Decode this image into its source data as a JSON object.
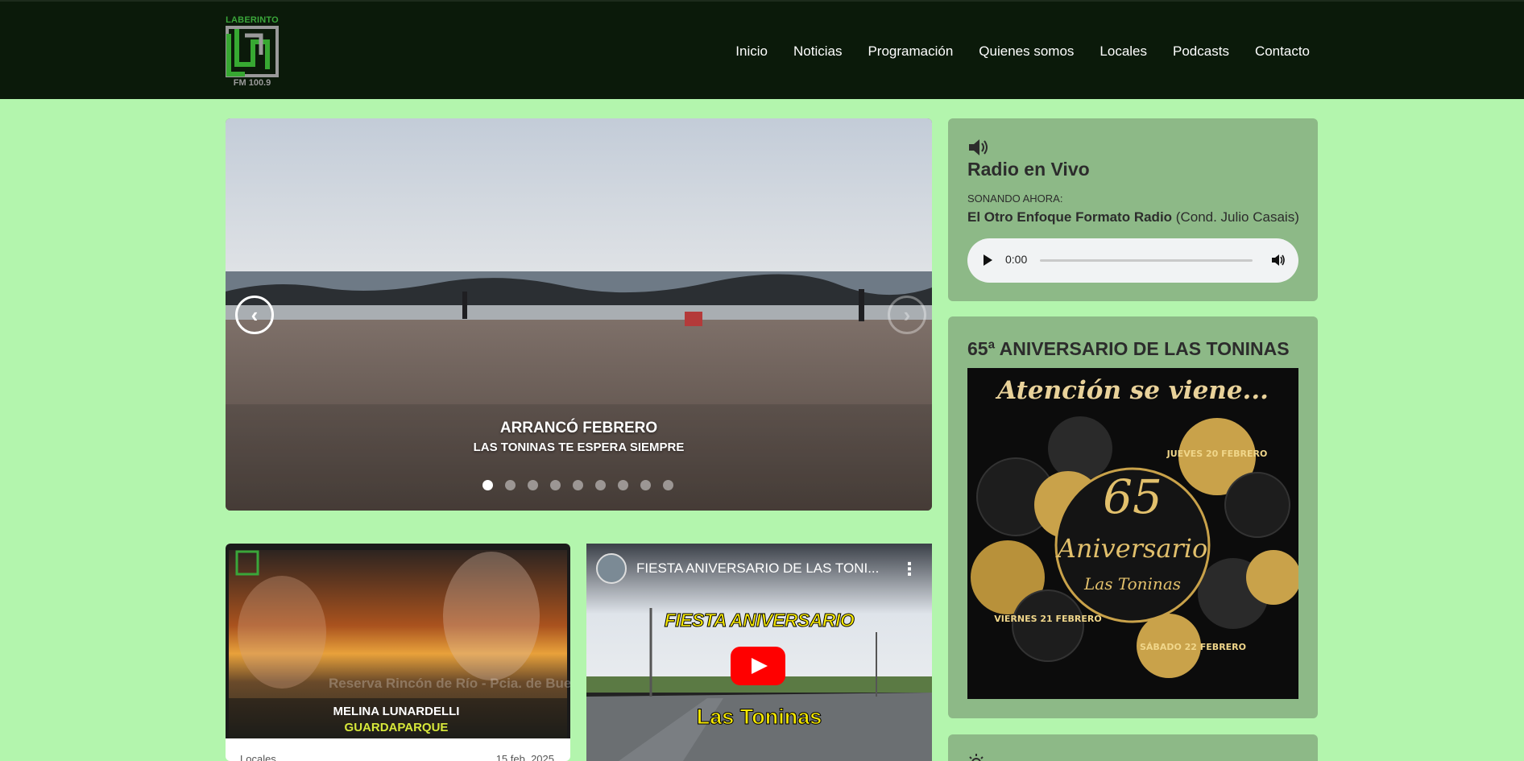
{
  "header": {
    "logo_top": "LABERINTO",
    "logo_bottom": "FM 100.9",
    "nav": [
      "Inicio",
      "Noticias",
      "Programación",
      "Quienes somos",
      "Locales",
      "Podcasts",
      "Contacto"
    ]
  },
  "carousel": {
    "title": "ARRANCÓ FEBRERO",
    "subtitle": "LAS TONINAS TE ESPERA SIEMPRE",
    "slide_count": 9,
    "active_slide": 1,
    "prev_icon": "chevron-left-icon",
    "next_icon": "chevron-right-icon"
  },
  "cards": {
    "card1": {
      "overlay_name": "MELINA LUNARDELLI",
      "overlay_role": "GUARDAPARQUE",
      "overlay_caption": "Reserva Rincón de Río - Pcia. de Buenos Aires",
      "category": "Locales",
      "date": "15 feb, 2025"
    },
    "card2": {
      "video_title": "FIESTA ANIVERSARIO DE LAS TONI...",
      "poster_line1": "FIESTA ANIVERSARIO",
      "poster_line2": "Las Toninas"
    }
  },
  "sidebar": {
    "live": {
      "icon": "speaker-icon",
      "title": "Radio en Vivo",
      "now_label": "SONANDO AHORA:",
      "show_name": "El Otro Enfoque Formato Radio",
      "show_host": "(Cond. Julio Casais)",
      "player_time": "0:00"
    },
    "anniversary": {
      "title": "65ª ANIVERSARIO DE LAS TONINAS",
      "poster_heading": "Atención se viene...",
      "poster_center_number": "65",
      "poster_center_word": "Aniversario",
      "poster_center_place": "Las Toninas",
      "day1": "JUEVES 20 FEBRERO",
      "day2": "VIERNES 21 FEBRERO",
      "day3": "SÁBADO 22 FEBRERO"
    }
  },
  "colors": {
    "page_bg": "#b3f5ad",
    "header_bg": "#0b1a0a",
    "widget_bg": "#8db987",
    "accent_green": "#3aa63a"
  }
}
